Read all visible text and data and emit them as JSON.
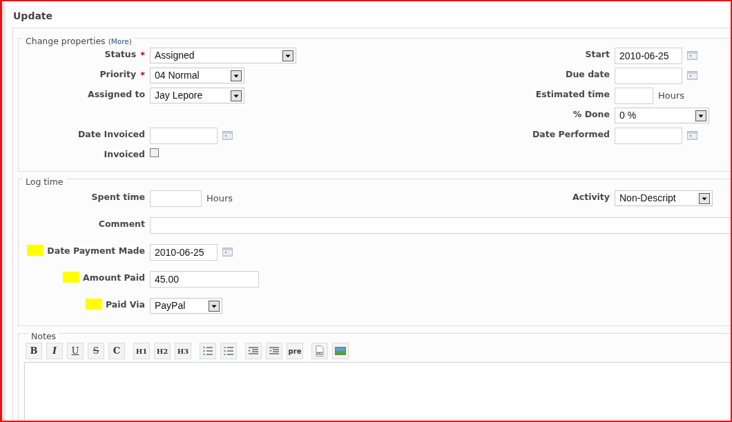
{
  "title": "Update",
  "change_properties": {
    "legend": "Change properties",
    "more_link": "(More)",
    "left_fields": [
      {
        "label": "Status",
        "required_mark": "*",
        "kind": "select",
        "value": "Assigned"
      },
      {
        "label": "Priority",
        "required_mark": "*",
        "kind": "select",
        "value": "04 Normal"
      },
      {
        "label": "Assigned to",
        "kind": "select",
        "value": "Jay Lepore"
      },
      {
        "label": "Date Invoiced",
        "kind": "date"
      },
      {
        "label": "Invoiced",
        "kind": "checkbox",
        "checked": false
      }
    ],
    "right_fields": [
      {
        "label": "Start",
        "kind": "date",
        "value": "2010-06-25"
      },
      {
        "label": "Due date",
        "kind": "date"
      },
      {
        "label": "Estimated time",
        "kind": "text",
        "unit": "Hours"
      },
      {
        "label": "% Done",
        "kind": "select",
        "value": "0 %"
      },
      {
        "label": "Date Performed",
        "kind": "date"
      }
    ]
  },
  "log_time": {
    "legend": "Log time",
    "spent_time": {
      "label": "Spent time",
      "unit": "Hours"
    },
    "activity": {
      "label": "Activity",
      "value": "Non-Descript"
    },
    "fields": [
      {
        "label": "Comment",
        "kind": "text",
        "highlighted": false
      },
      {
        "label": "Date Payment Made",
        "kind": "date",
        "value": "2010-06-25",
        "highlighted": true
      },
      {
        "label": "Amount Paid",
        "kind": "text",
        "value": "45.00",
        "highlighted": true
      },
      {
        "label": "Paid Via",
        "kind": "select",
        "value": "PayPal",
        "highlighted": true
      }
    ]
  },
  "notes": {
    "legend": "Notes",
    "toolbar": [
      [
        {
          "kind": "bold",
          "label": "B"
        },
        {
          "kind": "italic",
          "label": "I"
        },
        {
          "kind": "underline",
          "label": "U"
        },
        {
          "kind": "strike",
          "label": "S"
        },
        {
          "kind": "code",
          "label": "C"
        }
      ],
      [
        {
          "kind": "heading",
          "label": "H1"
        },
        {
          "kind": "heading",
          "label": "H2"
        },
        {
          "kind": "heading",
          "label": "H3"
        }
      ],
      [
        {
          "kind": "bullet-list"
        },
        {
          "kind": "numbered-list"
        }
      ],
      [
        {
          "kind": "indent"
        },
        {
          "kind": "outdent"
        },
        {
          "kind": "pre",
          "label": "pre"
        }
      ],
      [
        {
          "kind": "link"
        },
        {
          "kind": "image"
        }
      ]
    ]
  }
}
